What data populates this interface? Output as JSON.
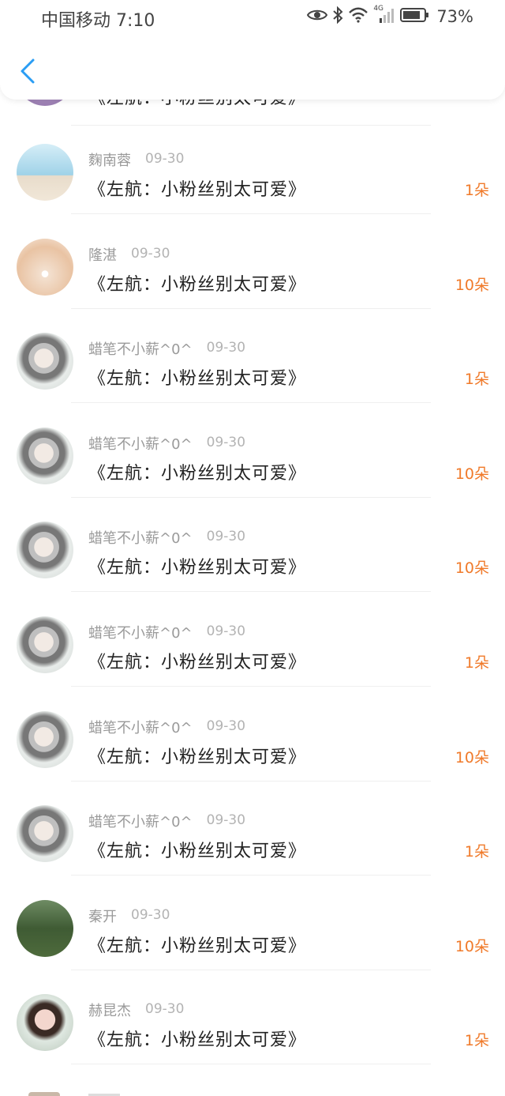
{
  "status_bar": {
    "carrier_time": "中国移动 7:10",
    "network": "4G",
    "battery": "73%"
  },
  "header": {
    "back_icon": "chevron-left-icon"
  },
  "list": {
    "partial_top_title": "《左航：小粉丝别太可爱》",
    "items": [
      {
        "name": "麴南蓉",
        "date": "09-30",
        "title": "《左航：小粉丝别太可爱》",
        "count": "1朵",
        "avatar": "beach"
      },
      {
        "name": "隆湛",
        "date": "09-30",
        "title": "《左航：小粉丝别太可爱》",
        "count": "10朵",
        "avatar": "shell"
      },
      {
        "name": "蜡笔不小薪^0^",
        "date": "09-30",
        "title": "《左航：小粉丝别太可爱》",
        "count": "1朵",
        "avatar": "portrait"
      },
      {
        "name": "蜡笔不小薪^0^",
        "date": "09-30",
        "title": "《左航：小粉丝别太可爱》",
        "count": "10朵",
        "avatar": "portrait"
      },
      {
        "name": "蜡笔不小薪^0^",
        "date": "09-30",
        "title": "《左航：小粉丝别太可爱》",
        "count": "10朵",
        "avatar": "portrait"
      },
      {
        "name": "蜡笔不小薪^0^",
        "date": "09-30",
        "title": "《左航：小粉丝别太可爱》",
        "count": "1朵",
        "avatar": "portrait"
      },
      {
        "name": "蜡笔不小薪^0^",
        "date": "09-30",
        "title": "《左航：小粉丝别太可爱》",
        "count": "10朵",
        "avatar": "portrait"
      },
      {
        "name": "蜡笔不小薪^0^",
        "date": "09-30",
        "title": "《左航：小粉丝别太可爱》",
        "count": "1朵",
        "avatar": "portrait"
      },
      {
        "name": "秦开",
        "date": "09-30",
        "title": "《左航：小粉丝别太可爱》",
        "count": "10朵",
        "avatar": "forest"
      },
      {
        "name": "赫昆杰",
        "date": "09-30",
        "title": "《左航：小粉丝别太可爱》",
        "count": "1朵",
        "avatar": "flowers"
      }
    ]
  },
  "colors": {
    "accent_back": "#2a9df4",
    "count_orange": "#f07a2a",
    "name_gray": "#9a9a9a"
  }
}
